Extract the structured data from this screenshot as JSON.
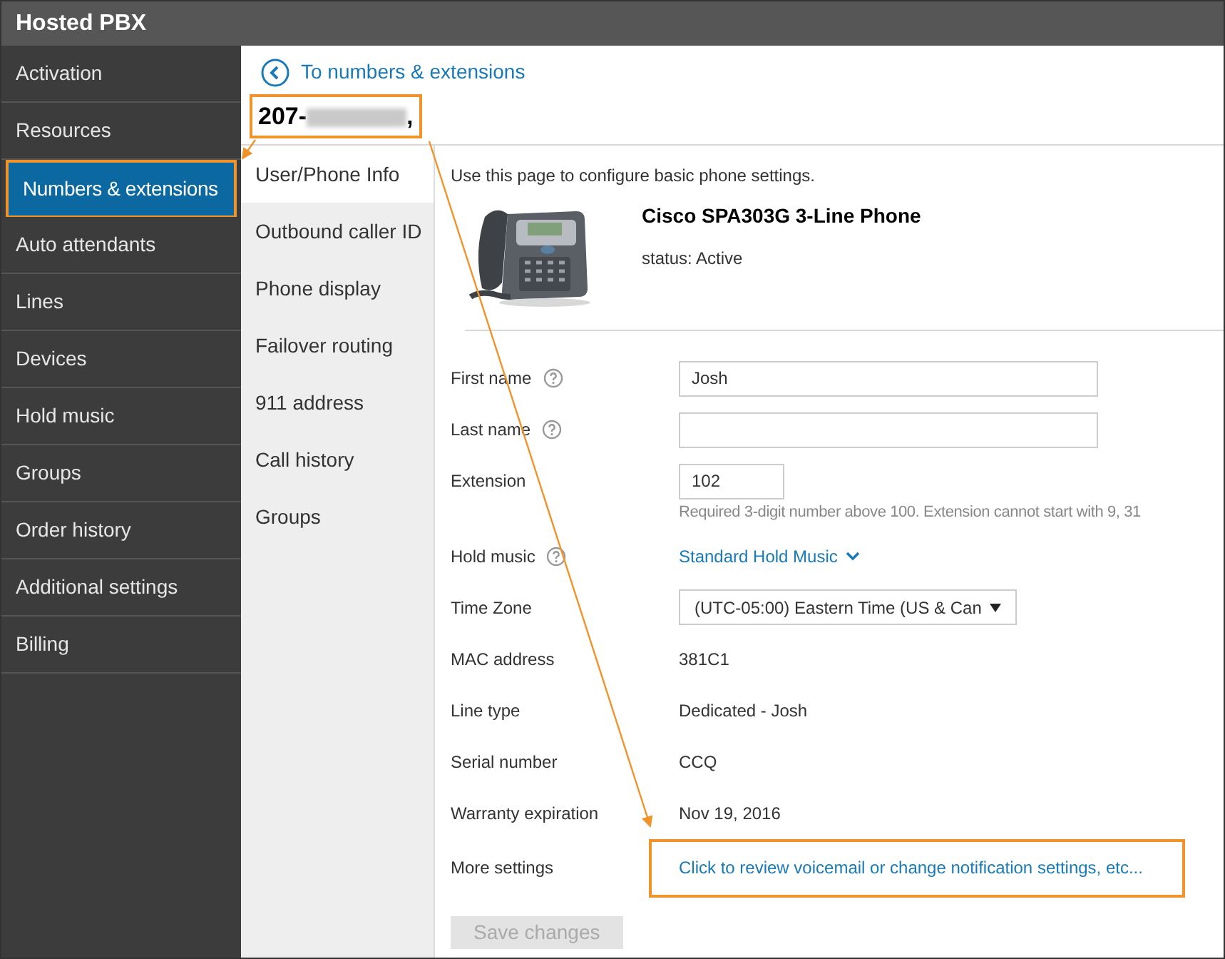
{
  "app_title": "Hosted PBX",
  "sidebar": {
    "items": [
      {
        "label": "Activation",
        "selected": false,
        "highlighted": false
      },
      {
        "label": "Resources",
        "selected": false,
        "highlighted": false
      },
      {
        "label": "Numbers & extensions",
        "selected": true,
        "highlighted": true
      },
      {
        "label": "Auto attendants",
        "selected": false,
        "highlighted": false
      },
      {
        "label": "Lines",
        "selected": false,
        "highlighted": false
      },
      {
        "label": "Devices",
        "selected": false,
        "highlighted": false
      },
      {
        "label": "Hold music",
        "selected": false,
        "highlighted": false
      },
      {
        "label": "Groups",
        "selected": false,
        "highlighted": false
      },
      {
        "label": "Order history",
        "selected": false,
        "highlighted": false
      },
      {
        "label": "Additional settings",
        "selected": false,
        "highlighted": false
      },
      {
        "label": "Billing",
        "selected": false,
        "highlighted": false
      }
    ]
  },
  "back_link": "To numbers & extensions",
  "number_heading": {
    "prefix": "207-",
    "suffix": ",",
    "redacted": true,
    "highlighted": true
  },
  "tabs": [
    {
      "label": "User/Phone Info",
      "selected": true
    },
    {
      "label": "Outbound caller ID",
      "selected": false
    },
    {
      "label": "Phone display",
      "selected": false
    },
    {
      "label": "Failover routing",
      "selected": false
    },
    {
      "label": "911 address",
      "selected": false
    },
    {
      "label": "Call history",
      "selected": false
    },
    {
      "label": "Groups",
      "selected": false
    }
  ],
  "intro": "Use this page to configure basic phone settings.",
  "device": {
    "name": "Cisco SPA303G 3-Line Phone",
    "status": "status: Active"
  },
  "fields": [
    {
      "kind": "input",
      "label": "First name",
      "help": true,
      "value": "Josh"
    },
    {
      "kind": "input",
      "label": "Last name",
      "help": true
    },
    {
      "kind": "short-input",
      "label": "Extension",
      "help": false,
      "value": "102",
      "hint": "Required 3-digit number above 100. Extension cannot start with 9, 31"
    },
    {
      "kind": "dropdown-link",
      "label": "Hold music",
      "help": true,
      "value": "Standard Hold Music"
    },
    {
      "kind": "select",
      "label": "Time Zone",
      "help": false,
      "value": "(UTC-05:00) Eastern Time (US & Can"
    },
    {
      "kind": "text",
      "label": "MAC address",
      "help": false,
      "value": "381C1"
    },
    {
      "kind": "text",
      "label": "Line type",
      "help": false,
      "value": "Dedicated - Josh"
    },
    {
      "kind": "text",
      "label": "Serial number",
      "help": false,
      "value": "CCQ"
    },
    {
      "kind": "text",
      "label": "Warranty expiration",
      "help": false,
      "value": "Nov 19, 2016"
    },
    {
      "kind": "link",
      "label": "More settings",
      "help": false,
      "value": "Click to review voicemail or change notification settings, etc...",
      "highlighted": true
    }
  ],
  "save_button": {
    "label": "Save changes",
    "disabled": true
  }
}
